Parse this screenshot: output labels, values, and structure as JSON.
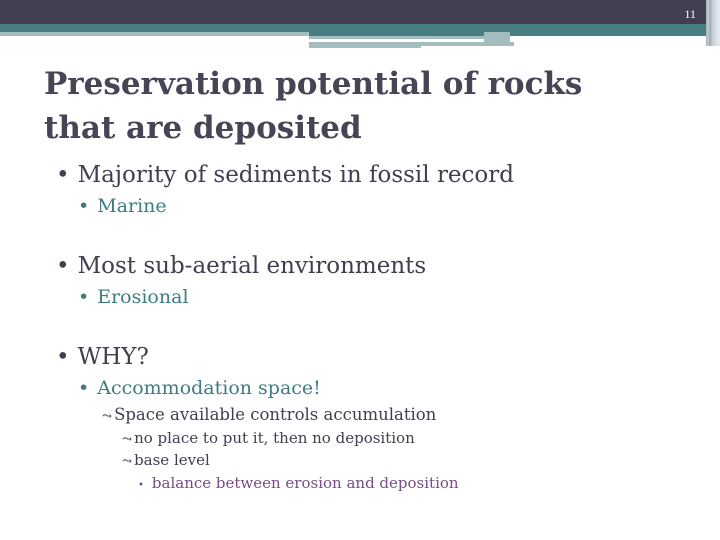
{
  "slide_number": "11",
  "title": "Preservation potential of rocks that are deposited",
  "bullets": [
    {
      "text": "Majority of sediments in fossil record",
      "sub": "Marine"
    },
    {
      "text": "Most sub-aerial environments",
      "sub": "Erosional"
    },
    {
      "text": "WHY?",
      "sub": "Accommodation space!",
      "l3": "Space available controls accumulation",
      "l4a": "no place to put it, then no deposition",
      "l4b": "base level",
      "l5": "balance between erosion and deposition"
    }
  ],
  "glyphs": {
    "bullet": "•",
    "arrow": "⤳"
  },
  "colors": {
    "header": "#414052",
    "teal": "#487d82",
    "light": "#a3bcbf",
    "purple": "#7a4a88"
  }
}
